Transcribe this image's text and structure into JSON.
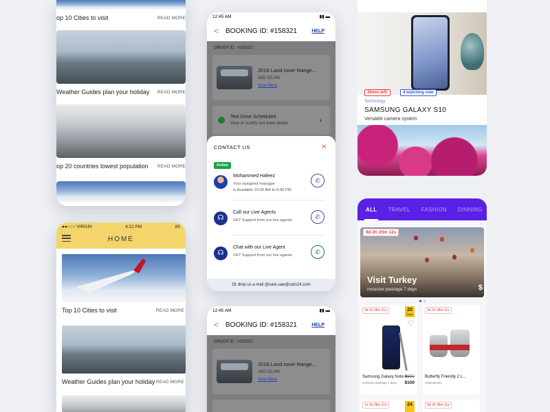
{
  "travel": {
    "items": [
      {
        "title": "op 10 Cities to visit",
        "more": "READ MORE"
      },
      {
        "title": "Weather Guides plan your holiday",
        "more": "READ MORE"
      },
      {
        "title": "op 20 countries lowest population",
        "more": "READ MORE"
      }
    ],
    "home": {
      "carrier": "●●○○○ VIRGIN",
      "time": "4:21 PM",
      "battery": "80",
      "title": "HOME",
      "items": [
        {
          "title": "Top 10 Cities to visit",
          "more": "READ MORE"
        },
        {
          "title": "Weather Guides plan your holiday",
          "more": "READ MORE"
        }
      ]
    }
  },
  "booking": {
    "time": "12:45 AM",
    "title": "BOOKING ID: #158321",
    "help": "HELP",
    "order_id": "ORDER ID : #158321",
    "car_name": "2016 Land rover Range...",
    "car_price": "AED 53,000",
    "view_more": "View More",
    "test_drive_title": "Test Drive Scheduled",
    "test_drive_sub": "View or modify test drive details",
    "contact": {
      "title": "CONTACT US",
      "online": "Online",
      "manager_name": "Mohammed Hafeez",
      "manager_sub1": "Your assigned manager",
      "manager_sub2": "is Available 10:00 AM to 6:00 PM",
      "live_agents_title": "Call our Live Agents",
      "live_agents_sub": "24/7 Support from our live agents",
      "chat_title": "Chat with our Live Agent",
      "chat_sub": "24/7 Support from our live agents",
      "footer": "Or drop us a mail @care.uae@cars24.com"
    }
  },
  "shop": {
    "tag_time": "30min left!",
    "tag_watching": "4 watching now",
    "category": "Technology",
    "product_name": "SAMSUNG GALAXY S10",
    "product_desc": "Versatile camera system",
    "tabs": [
      "ALL",
      "TRAVEL",
      "FASHION",
      "DINNING"
    ],
    "hero": {
      "timer": "9d 2h 23m 12s",
      "title": "Visit Turkey",
      "subtitle": "inclusive package 7 days",
      "price": "$"
    },
    "products": [
      {
        "timer": "9d 1h 38m 11s",
        "days": "20",
        "days_label": "Days",
        "name": "Samsung Galaxy Note 8",
        "sub": "Inclusive package 7 days",
        "old_price": "$690",
        "new_price": "$100"
      },
      {
        "timer": "9d 2h 38m 11s",
        "name": "Butterfly Friendly 2 L...",
        "sub": "(Aluminium)"
      }
    ],
    "products_row2": [
      {
        "timer": "1d 3h 38m 11s",
        "days": "24"
      },
      {
        "timer": "9d 2h 38m 11s"
      }
    ],
    "colors": {
      "accent": "#5b1fe6",
      "alert": "#e23b3b",
      "brand_orange": "#e8692d",
      "home_header": "#f3d56c"
    }
  }
}
